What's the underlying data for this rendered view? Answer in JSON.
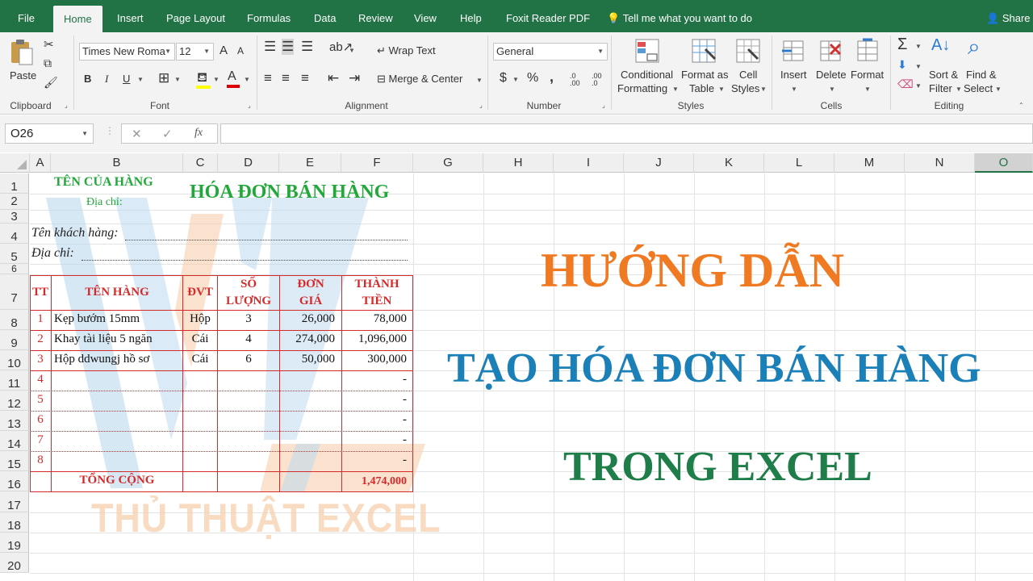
{
  "menu": {
    "tabs": [
      "File",
      "Home",
      "Insert",
      "Page Layout",
      "Formulas",
      "Data",
      "Review",
      "View",
      "Help",
      "Foxit Reader PDF"
    ],
    "tell_me": "Tell me what you want to do",
    "share": "Share"
  },
  "ribbon": {
    "clipboard": {
      "paste": "Paste",
      "group": "Clipboard"
    },
    "font": {
      "name": "Times New Roma",
      "size": "12",
      "bold": "B",
      "italic": "I",
      "underline": "U",
      "grow": "A",
      "shrink": "A",
      "color_a": "A",
      "group": "Font"
    },
    "alignment": {
      "wrap": "Wrap Text",
      "merge": "Merge & Center",
      "group": "Alignment"
    },
    "number": {
      "format": "General",
      "currency": "$",
      "percent": "%",
      "comma": ",",
      "inc": ".0 .00",
      "dec": ".00 .0",
      "group": "Number"
    },
    "styles": {
      "cond1": "Conditional",
      "cond2": "Formatting",
      "fmt1": "Format as",
      "fmt2": "Table",
      "cell1": "Cell",
      "cell2": "Styles",
      "group": "Styles"
    },
    "cells": {
      "insert": "Insert",
      "delete": "Delete",
      "format": "Format",
      "group": "Cells"
    },
    "editing": {
      "sort1": "Sort &",
      "sort2": "Filter",
      "find1": "Find &",
      "find2": "Select",
      "group": "Editing"
    }
  },
  "formula_bar": {
    "name_box": "O26",
    "cancel": "✕",
    "enter": "✓",
    "fx": "fx",
    "value": ""
  },
  "columns": [
    "A",
    "B",
    "C",
    "D",
    "E",
    "F",
    "G",
    "H",
    "I",
    "J",
    "K",
    "L",
    "M",
    "N",
    "O"
  ],
  "rows": [
    "1",
    "2",
    "3",
    "4",
    "5",
    "6",
    "7",
    "8",
    "9",
    "10",
    "11",
    "12",
    "13",
    "14",
    "15",
    "16",
    "17",
    "18",
    "19",
    "20"
  ],
  "invoice": {
    "store": "TÊN CỦA HÀNG",
    "store_addr": "Địa chỉ:",
    "title": "HÓA ĐƠN BÁN HÀNG",
    "customer": "Tên khách hàng:",
    "cust_addr": "Địa chỉ:",
    "headers": {
      "tt": "TT",
      "name": "TÊN HÀNG",
      "unit": "ĐVT",
      "qty1": "SỐ",
      "qty2": "LƯỢNG",
      "price1": "ĐƠN",
      "price2": "GIÁ",
      "total1": "THÀNH",
      "total2": "TIỀN"
    },
    "items": [
      {
        "tt": "1",
        "name": "Kẹp bướm 15mm",
        "unit": "Hộp",
        "qty": "3",
        "price": "26,000",
        "total": "78,000"
      },
      {
        "tt": "2",
        "name": "Khay tài liệu 5 ngăn",
        "unit": "Cái",
        "qty": "4",
        "price": "274,000",
        "total": "1,096,000"
      },
      {
        "tt": "3",
        "name": "Hộp ddwungj hồ sơ",
        "unit": "Cái",
        "qty": "6",
        "price": "50,000",
        "total": "300,000"
      },
      {
        "tt": "4",
        "name": "",
        "unit": "",
        "qty": "",
        "price": "",
        "total": "-"
      },
      {
        "tt": "5",
        "name": "",
        "unit": "",
        "qty": "",
        "price": "",
        "total": "-"
      },
      {
        "tt": "6",
        "name": "",
        "unit": "",
        "qty": "",
        "price": "",
        "total": "-"
      },
      {
        "tt": "7",
        "name": "",
        "unit": "",
        "qty": "",
        "price": "",
        "total": "-"
      },
      {
        "tt": "8",
        "name": "",
        "unit": "",
        "qty": "",
        "price": "",
        "total": "-"
      }
    ],
    "sum_label": "TỔNG CỘNG",
    "sum_value": "1,474,000"
  },
  "overlay": {
    "line1": "HƯỚNG DẪN",
    "line2": "TẠO HÓA ĐƠN BÁN HÀNG",
    "line3": "TRONG EXCEL",
    "watermark": "THỦ THUẬT EXCEL"
  },
  "colors": {
    "excel_green": "#217346",
    "red": "#d42a2a",
    "title_green": "#22a83a",
    "orange": "#f07a22",
    "blue": "#1b80b8",
    "dark_green": "#1e7d48"
  }
}
